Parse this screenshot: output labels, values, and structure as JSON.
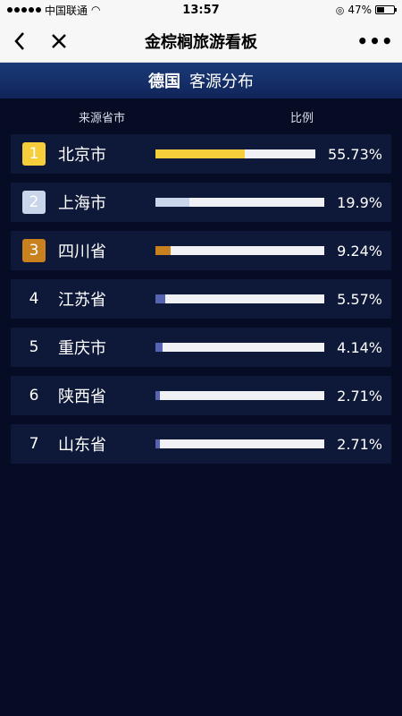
{
  "status": {
    "carrier": "中国联通",
    "time": "13:57",
    "battery": "47%",
    "battery_level": 0.47
  },
  "nav": {
    "back_icon": "chevron-left-icon",
    "close_icon": "close-icon",
    "title": "金棕榈旅游看板",
    "more_icon": "more-icon",
    "more_label": "•••"
  },
  "header": {
    "country": "德国",
    "subtitle": "客源分布"
  },
  "columns": {
    "source": "来源省市",
    "ratio": "比例"
  },
  "colors": {
    "gold": "#f6cd3a",
    "silver": "#c9d5ea",
    "bronze": "#c9811f",
    "blue": "#5563b0"
  },
  "rows": [
    {
      "rank": "1",
      "city": "北京市",
      "pct": "55.73%",
      "value": 55.73,
      "style": "gold"
    },
    {
      "rank": "2",
      "city": "上海市",
      "pct": "19.9%",
      "value": 19.9,
      "style": "silver"
    },
    {
      "rank": "3",
      "city": "四川省",
      "pct": "9.24%",
      "value": 9.24,
      "style": "bronze"
    },
    {
      "rank": "4",
      "city": "江苏省",
      "pct": "5.57%",
      "value": 5.57,
      "style": "blue"
    },
    {
      "rank": "5",
      "city": "重庆市",
      "pct": "4.14%",
      "value": 4.14,
      "style": "blue"
    },
    {
      "rank": "6",
      "city": "陕西省",
      "pct": "2.71%",
      "value": 2.71,
      "style": "blue"
    },
    {
      "rank": "7",
      "city": "山东省",
      "pct": "2.71%",
      "value": 2.71,
      "style": "blue"
    }
  ]
}
